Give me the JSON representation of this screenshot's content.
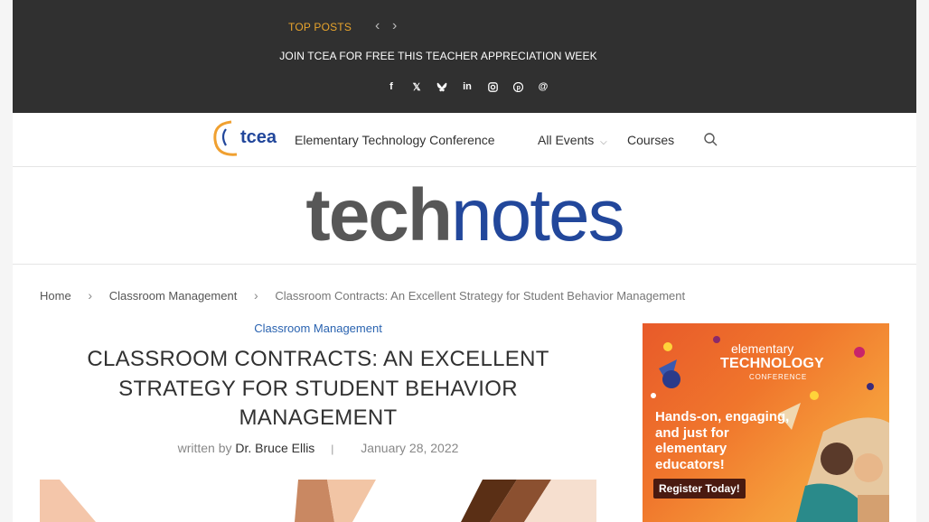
{
  "topbar": {
    "label": "TOP POSTS",
    "headline": "JOIN TCEA FOR FREE THIS TEACHER APPRECIATION WEEK",
    "socials": [
      "facebook-icon",
      "x-icon",
      "bluesky-icon",
      "linkedin-icon",
      "instagram-icon",
      "pinterest-icon",
      "threads-icon"
    ]
  },
  "nav": {
    "logo_text": "tcea",
    "items": [
      {
        "label": "Elementary Technology Conference"
      },
      {
        "label": "All Events"
      },
      {
        "label": "Courses"
      }
    ]
  },
  "masthead": {
    "part1": "tech",
    "part2": "notes"
  },
  "breadcrumb": [
    {
      "label": "Home"
    },
    {
      "label": "Classroom Management"
    },
    {
      "label": "Classroom Contracts: An Excellent Strategy for Student Behavior Management"
    }
  ],
  "article": {
    "category": "Classroom Management",
    "title": "CLASSROOM CONTRACTS: AN EXCELLENT STRATEGY FOR STUDENT BEHAVIOR MANAGEMENT",
    "byline_prefix": "written by",
    "author": "Dr. Bruce Ellis",
    "date": "January 28, 2022"
  },
  "ad": {
    "line1": "elementary",
    "line2": "TECHNOLOGY",
    "line3": "CONFERENCE",
    "body": "Hands-on, engaging, and just for elementary educators!",
    "button": "Register Today!"
  },
  "colors": {
    "topbar_bg": "#303030",
    "accent_orange": "#e8a42c",
    "link_blue": "#2a63b0",
    "brand_blue": "#22479b"
  }
}
